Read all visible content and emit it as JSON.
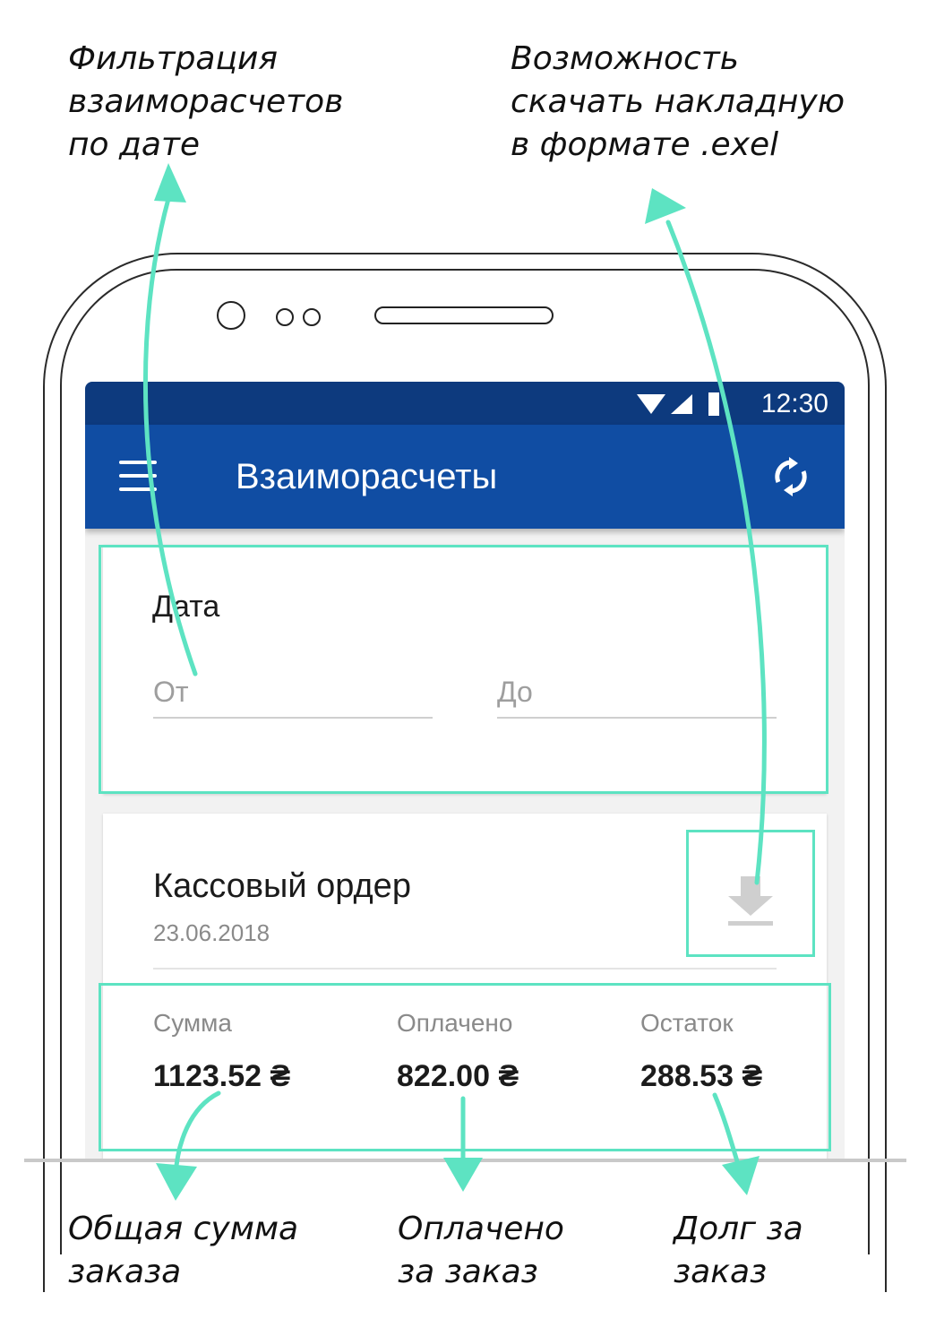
{
  "annotations": {
    "filter": "Фильтрация\nвзаиморасчетов\nпо дате",
    "download": "Возможность\nскачать накладную\nв формате .exel",
    "total": "Общая сумма\nзаказа",
    "paid": "Оплачено\nза заказ",
    "debt": "Долг за\nзаказ"
  },
  "status_bar": {
    "time": "12:30"
  },
  "app_bar": {
    "title": "Взаиморасчеты"
  },
  "filter_card": {
    "label": "Дата",
    "from_placeholder": "От",
    "to_placeholder": "До"
  },
  "order_card": {
    "title": "Кассовый ордер",
    "date": "23.06.2018",
    "columns": [
      {
        "label": "Сумма",
        "value": "1123.52 ₴"
      },
      {
        "label": "Оплачено",
        "value": "822.00 ₴"
      },
      {
        "label": "Остаток",
        "value": "288.53 ₴"
      }
    ]
  },
  "colors": {
    "status_bar": "#0d3a7e",
    "app_bar": "#104da3",
    "highlight": "#5de3c2"
  },
  "icons": [
    "menu-icon",
    "sync-icon",
    "download-icon",
    "wifi-icon",
    "signal-icon",
    "battery-icon"
  ]
}
